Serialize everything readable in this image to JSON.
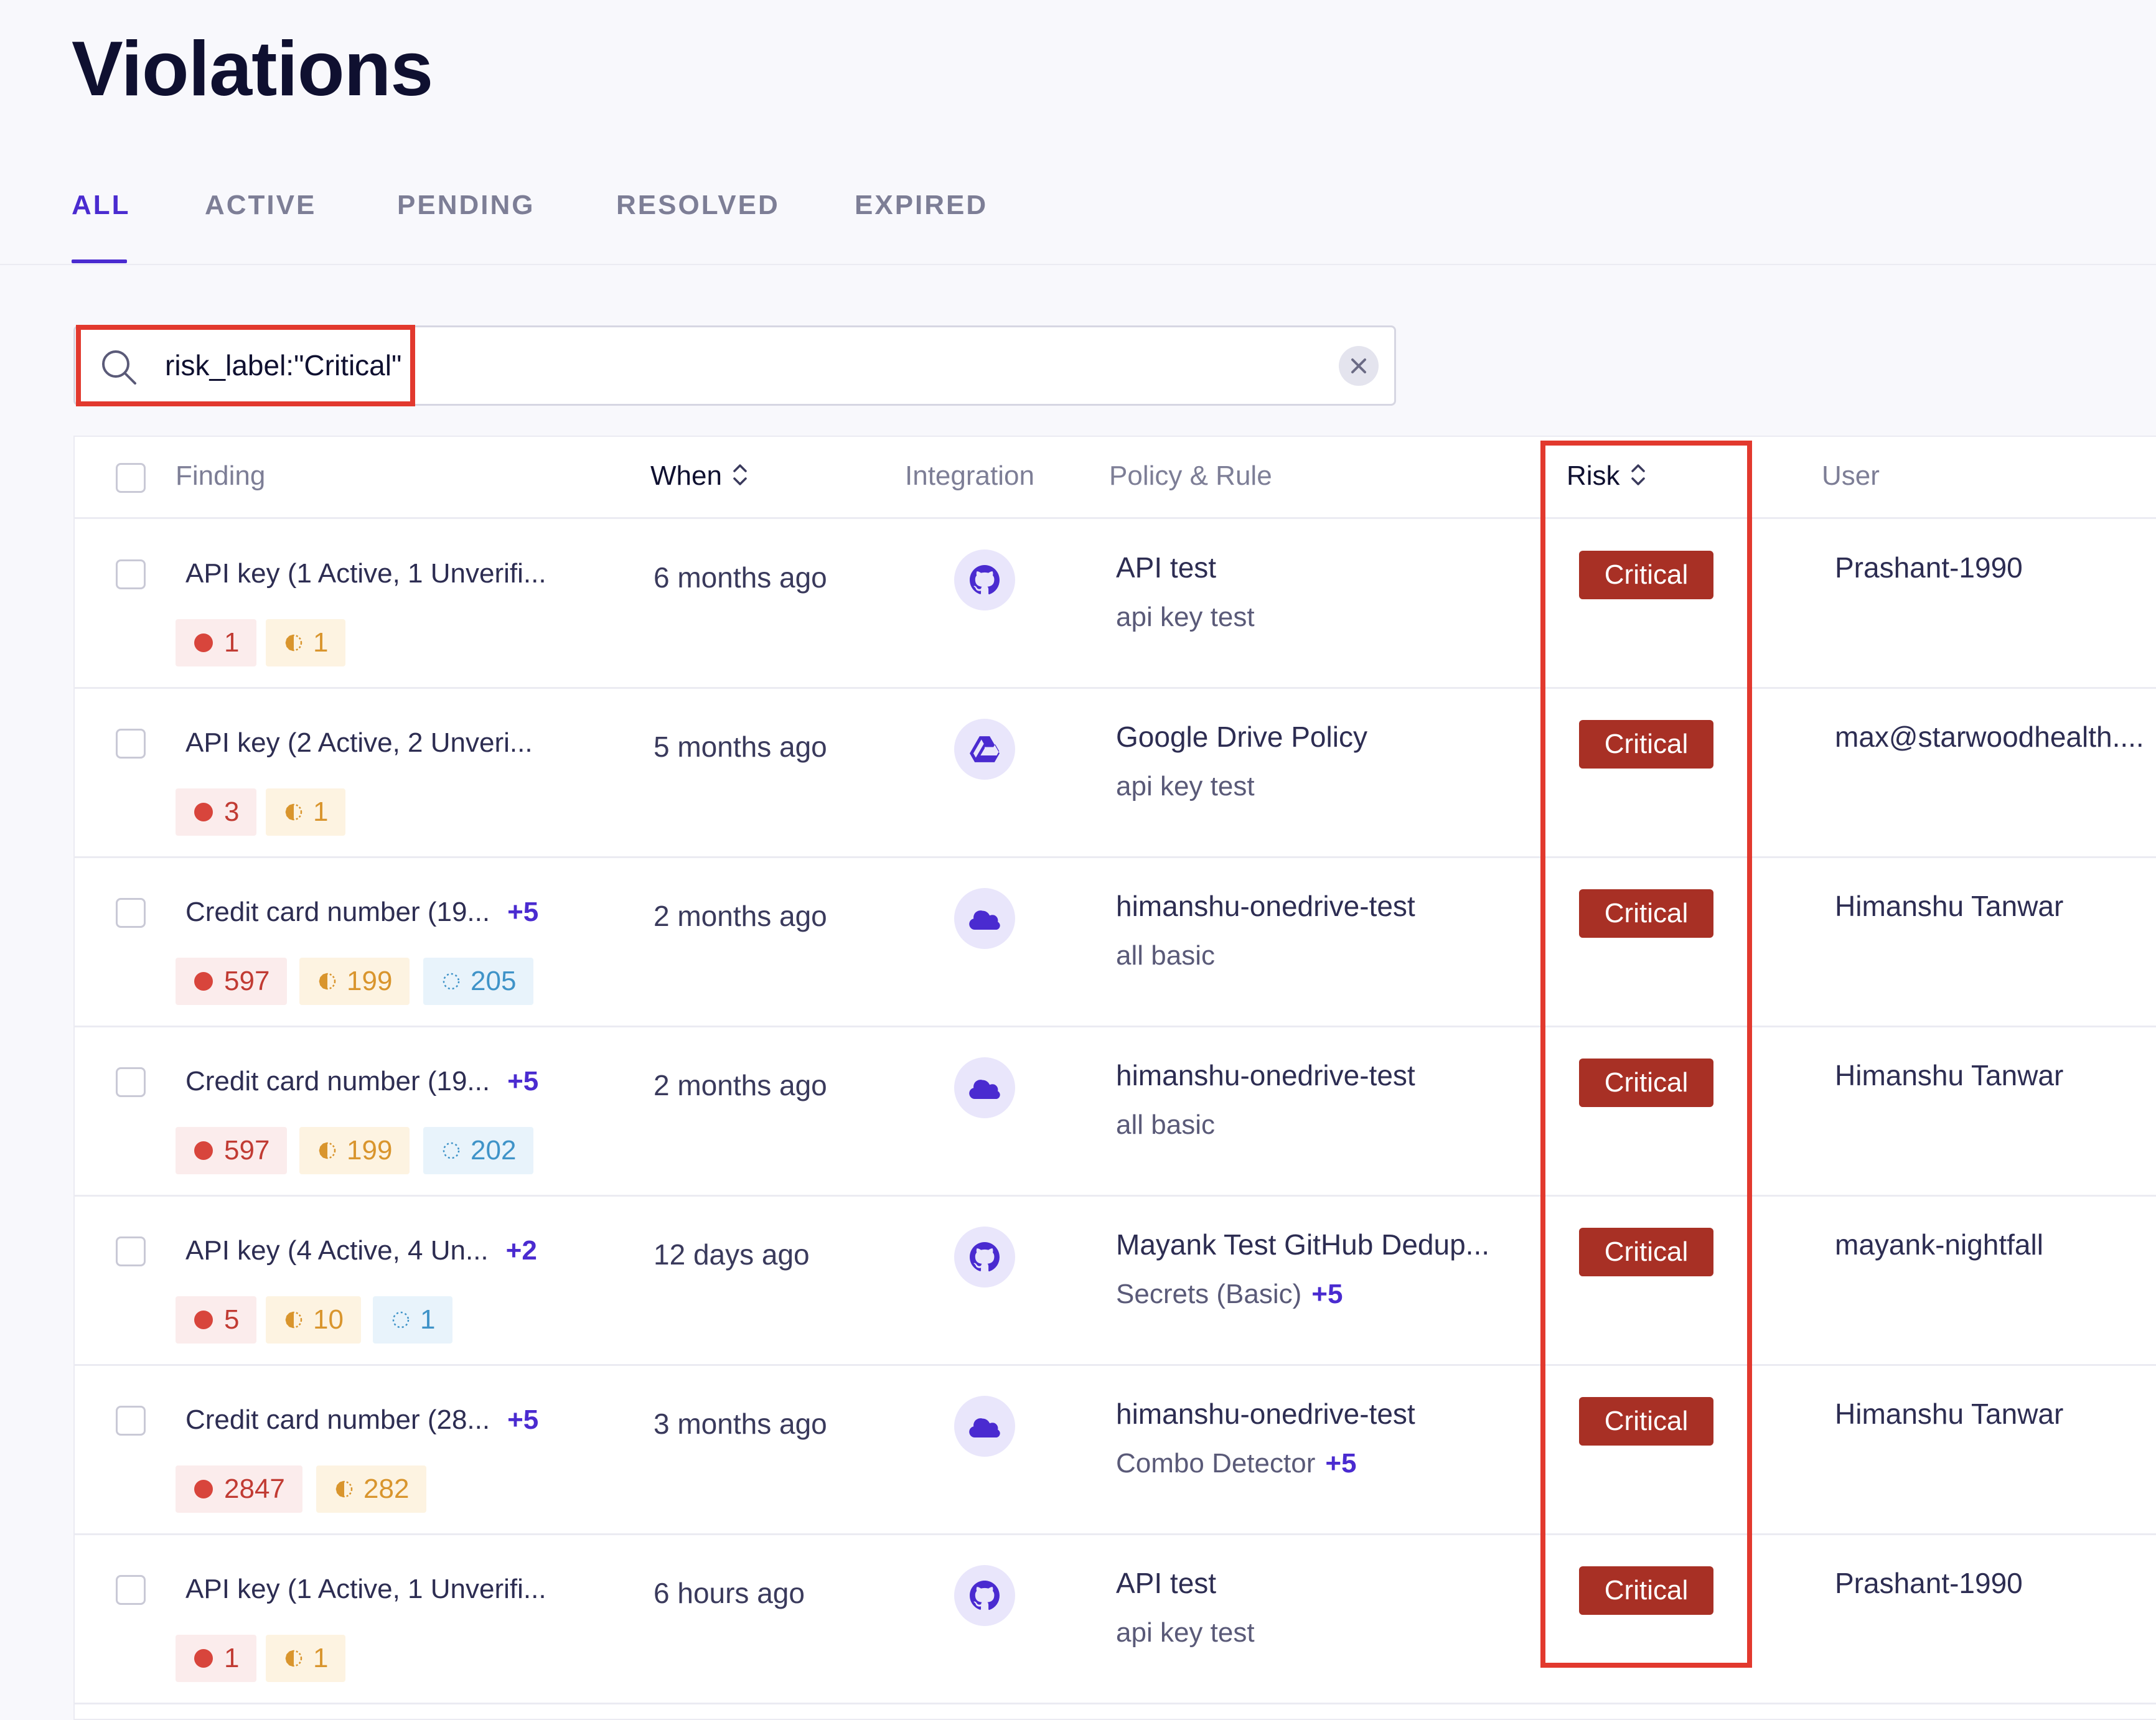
{
  "page": {
    "title": "Violations"
  },
  "tabs": [
    {
      "label": "ALL",
      "active": true
    },
    {
      "label": "ACTIVE",
      "active": false
    },
    {
      "label": "PENDING",
      "active": false
    },
    {
      "label": "RESOLVED",
      "active": false
    },
    {
      "label": "EXPIRED",
      "active": false
    }
  ],
  "search": {
    "value": "risk_label:\"Critical\"",
    "icon": "search-icon",
    "clear_icon": "close-icon"
  },
  "table": {
    "columns": {
      "finding": "Finding",
      "when": "When",
      "integration": "Integration",
      "policy": "Policy & Rule",
      "risk": "Risk",
      "user": "User"
    },
    "rows": [
      {
        "finding": "API key (1 Active, 1 Unverifi...",
        "more": "",
        "chips": [
          {
            "kind": "red",
            "count": "1"
          },
          {
            "kind": "orange",
            "count": "1"
          }
        ],
        "when": "6 months ago",
        "integration": "github",
        "policy": "API test",
        "rule": "api key test",
        "rule_more": "",
        "risk": "Critical",
        "user": "Prashant-1990"
      },
      {
        "finding": "API key (2 Active, 2 Unveri...",
        "more": "",
        "chips": [
          {
            "kind": "red",
            "count": "3"
          },
          {
            "kind": "orange",
            "count": "1"
          }
        ],
        "when": "5 months ago",
        "integration": "google-drive",
        "policy": "Google Drive Policy",
        "rule": "api key test",
        "rule_more": "",
        "risk": "Critical",
        "user": "max@starwoodhealth...."
      },
      {
        "finding": "Credit card number (19...",
        "more": "+5",
        "chips": [
          {
            "kind": "red",
            "count": "597"
          },
          {
            "kind": "orange",
            "count": "199"
          },
          {
            "kind": "blue",
            "count": "205"
          }
        ],
        "when": "2 months ago",
        "integration": "onedrive",
        "policy": "himanshu-onedrive-test",
        "rule": "all basic",
        "rule_more": "",
        "risk": "Critical",
        "user": "Himanshu Tanwar"
      },
      {
        "finding": "Credit card number (19...",
        "more": "+5",
        "chips": [
          {
            "kind": "red",
            "count": "597"
          },
          {
            "kind": "orange",
            "count": "199"
          },
          {
            "kind": "blue",
            "count": "202"
          }
        ],
        "when": "2 months ago",
        "integration": "onedrive",
        "policy": "himanshu-onedrive-test",
        "rule": "all basic",
        "rule_more": "",
        "risk": "Critical",
        "user": "Himanshu Tanwar"
      },
      {
        "finding": "API key (4 Active, 4 Un...",
        "more": "+2",
        "chips": [
          {
            "kind": "red",
            "count": "5"
          },
          {
            "kind": "orange",
            "count": "10"
          },
          {
            "kind": "blue",
            "count": "1"
          }
        ],
        "when": "12 days ago",
        "integration": "github",
        "policy": "Mayank Test GitHub Dedup...",
        "rule": "Secrets (Basic)",
        "rule_more": "+5",
        "risk": "Critical",
        "user": "mayank-nightfall"
      },
      {
        "finding": "Credit card number (28...",
        "more": "+5",
        "chips": [
          {
            "kind": "red",
            "count": "2847"
          },
          {
            "kind": "orange",
            "count": "282"
          }
        ],
        "when": "3 months ago",
        "integration": "onedrive",
        "policy": "himanshu-onedrive-test",
        "rule": "Combo Detector",
        "rule_more": "+5",
        "risk": "Critical",
        "user": "Himanshu Tanwar"
      },
      {
        "finding": "API key (1 Active, 1 Unverifi...",
        "more": "",
        "chips": [
          {
            "kind": "red",
            "count": "1"
          },
          {
            "kind": "orange",
            "count": "1"
          }
        ],
        "when": "6 hours ago",
        "integration": "github",
        "policy": "API test",
        "rule": "api key test",
        "rule_more": "",
        "risk": "Critical",
        "user": "Prashant-1990"
      }
    ]
  },
  "colors": {
    "accent": "#4a2bd0",
    "critical": "#a83025",
    "highlight": "#e2392e"
  }
}
